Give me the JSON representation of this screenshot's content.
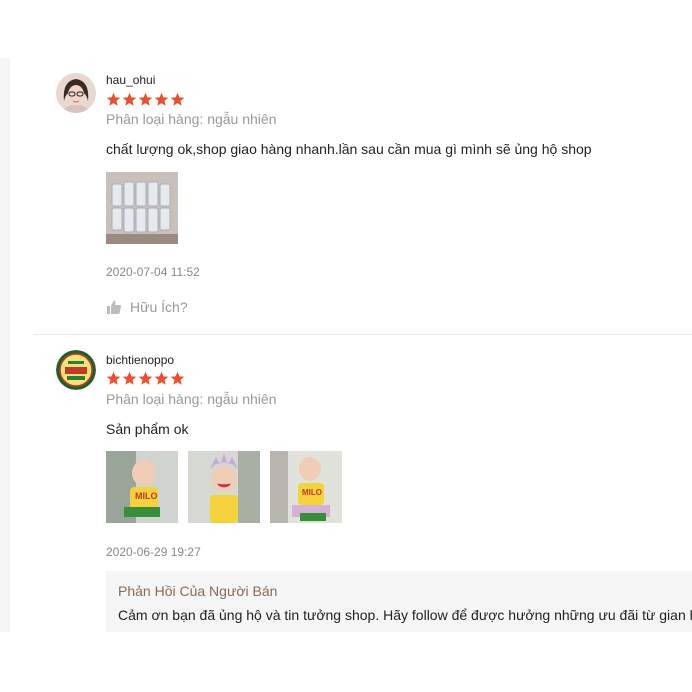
{
  "reviews": [
    {
      "username": "hau_ohui",
      "rating": 5,
      "variation": "Phân loại hàng: ngẫu nhiên",
      "comment": "chất lượng ok,shop giao hàng nhanh.lần sau cần mua gì mình sẽ ủng hộ shop",
      "photo_count": 1,
      "timestamp": "2020-07-04 11:52",
      "helpful_label": "Hữu Ích?"
    },
    {
      "username": "bichtienoppo",
      "rating": 5,
      "variation": "Phân loại hàng: ngẫu nhiên",
      "comment": "Sản phẩm ok",
      "photo_count": 3,
      "timestamp": "2020-06-29 19:27",
      "seller_reply": {
        "title": "Phản Hồi Của Người Bán",
        "text": "Cảm ơn bạn đã ủng hộ và tin tưởng shop. Hãy follow để được hưởng những ưu đãi từ gian h"
      }
    }
  ],
  "colors": {
    "star": "#ee4d2d",
    "muted": "#999999",
    "reply_title": "#8a6a54"
  }
}
